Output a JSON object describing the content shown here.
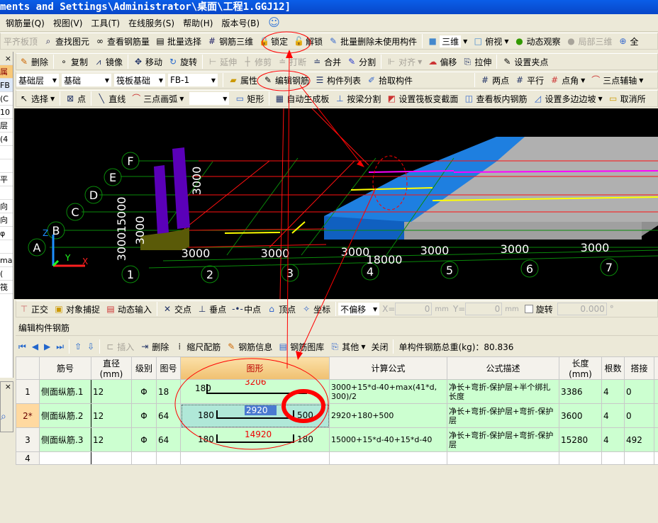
{
  "title": "ments and Settings\\Administrator\\桌面\\工程1.GGJ12]",
  "menu": [
    "钢筋量(Q)",
    "视图(V)",
    "工具(T)",
    "在线服务(S)",
    "帮助(H)",
    "版本号(B)"
  ],
  "toolbar1": {
    "items": [
      "平齐板顶",
      "查找图元",
      "查看钢筋量",
      "批量选择",
      "钢筋三维",
      "锁定",
      "解锁",
      "批量删除未使用构件"
    ],
    "view_select": "三维",
    "items2": [
      "俯视",
      "动态观察",
      "局部三维",
      "全"
    ]
  },
  "toolbar2": [
    "删除",
    "复制",
    "镜像",
    "移动",
    "旋转",
    "延伸",
    "修剪",
    "打断",
    "合并",
    "分割",
    "对齐",
    "偏移",
    "拉伸",
    "设置夹点"
  ],
  "toolbar3": {
    "selects": [
      "基础层",
      "基础",
      "筏板基础",
      "FB-1"
    ],
    "items": [
      "属性",
      "编辑钢筋",
      "构件列表",
      "拾取构件",
      "两点",
      "平行",
      "点角",
      "三点辅轴"
    ]
  },
  "toolbar4": [
    "选择",
    "点",
    "直线",
    "三点画弧",
    "矩形",
    "自动生成板",
    "按梁分割",
    "设置筏板变截面",
    "查看板内钢筋",
    "设置多边边坡",
    "取消所"
  ],
  "left_panel": [
    "属",
    "FB",
    "(C",
    "10",
    "层",
    "(4",
    "",
    "",
    "平",
    "",
    "向",
    "向",
    "φ",
    "",
    "ma",
    "(",
    "筏"
  ],
  "viewport": {
    "row_axes": [
      "A",
      "B",
      "C",
      "D",
      "E",
      "F"
    ],
    "col_axes": [
      "1",
      "2",
      "3",
      "4",
      "5",
      "6",
      "7"
    ],
    "col_dims": [
      "3000",
      "3000",
      "3000",
      "3000",
      "3000",
      "3000"
    ],
    "total_dim": "18000",
    "row_dims": [
      "3000",
      "3000",
      "15000",
      "3000"
    ],
    "axis_labels": {
      "z": "Z",
      "y": "Y",
      "x": "X"
    }
  },
  "snapbar": {
    "items": [
      "正交",
      "对象捕捉",
      "动态输入",
      "交点",
      "垂点",
      "中点",
      "顶点",
      "坐标"
    ],
    "offset_select": "不偏移",
    "x_label": "X=",
    "x_value": "0",
    "y_label": "Y=",
    "y_value": "0",
    "unit": "mm",
    "rotate_label": "旋转",
    "rotate_value": "0.000",
    "degree": "°"
  },
  "panel_title": "编辑构件钢筋",
  "rebar_toolbar": {
    "items": [
      "插入",
      "删除",
      "缩尺配筋",
      "钢筋信息",
      "钢筋图库",
      "其他",
      "关闭"
    ],
    "total_label": "单构件钢筋总重(kg)：80.836"
  },
  "table": {
    "headers": [
      "",
      "筋号",
      "直径(mm)",
      "级别",
      "图号",
      "图形",
      "计算公式",
      "公式描述",
      "长度(mm)",
      "根数",
      "搭接",
      ""
    ],
    "rows": [
      {
        "idx": "1",
        "name": "侧面纵筋.1",
        "dia": "12",
        "grade": "Φ",
        "fig": "18",
        "shape": {
          "left": "180",
          "mid": "3206",
          "right": ""
        },
        "formula": "3000+15*d-40+max(41*d, 300)/2",
        "desc": "净长+弯折-保护层+半个绑扎长度",
        "length": "3386",
        "count": "4",
        "lap": "0"
      },
      {
        "idx": "2*",
        "name": "侧面纵筋.2",
        "dia": "12",
        "grade": "Φ",
        "fig": "64",
        "shape": {
          "left": "180",
          "mid": "2920",
          "right": "500"
        },
        "formula": "2920+180+500",
        "desc": "净长+弯折-保护层+弯折-保护层",
        "length": "3600",
        "count": "4",
        "lap": "0"
      },
      {
        "idx": "3",
        "name": "侧面纵筋.3",
        "dia": "12",
        "grade": "Φ",
        "fig": "64",
        "shape": {
          "left": "180",
          "mid": "14920",
          "right": "180"
        },
        "formula": "15000+15*d-40+15*d-40",
        "desc": "净长+弯折-保护层+弯折-保护层",
        "length": "15280",
        "count": "4",
        "lap": "492"
      },
      {
        "idx": "4",
        "name": "",
        "dia": "",
        "grade": "",
        "fig": "",
        "shape": {
          "left": "",
          "mid": "",
          "right": ""
        },
        "formula": "",
        "desc": "",
        "length": "",
        "count": "",
        "lap": ""
      }
    ]
  },
  "colors": {
    "title_bar": "#0a5ee8",
    "row_bg": "#ccffd0",
    "annotation": "#ff0000",
    "grid_green": "#00a000",
    "beam_blue": "#1a6fd8",
    "column_purple": "#5a00b8"
  }
}
